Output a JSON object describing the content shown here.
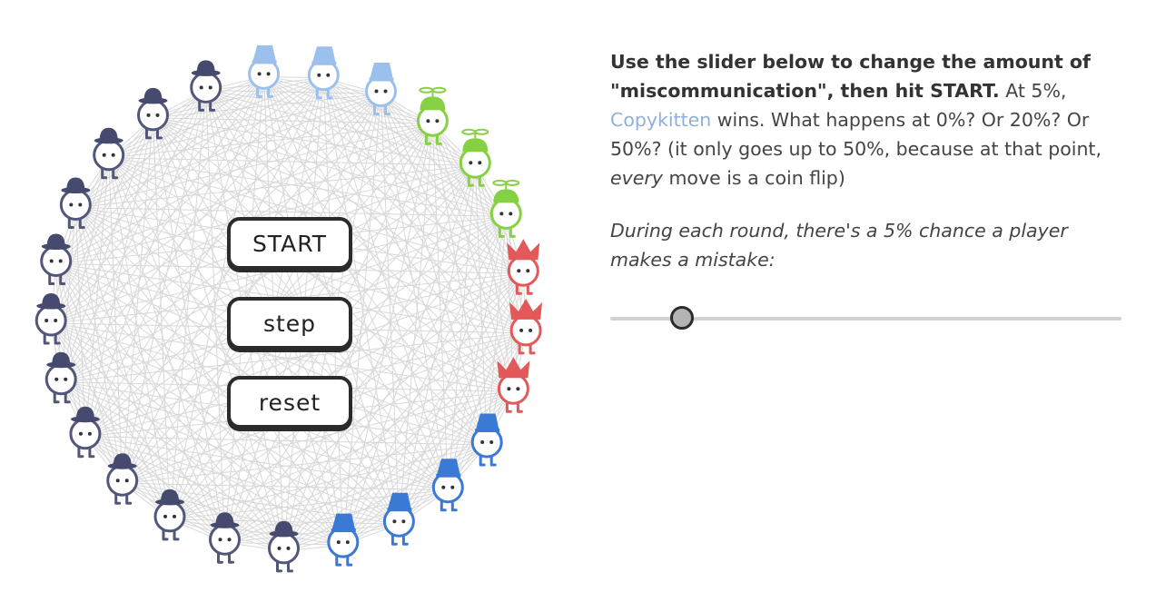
{
  "buttons": {
    "start": "START",
    "step": "step",
    "reset": "reset"
  },
  "words": {
    "bold_intro": "Use the slider below to change the amount of \"miscommunication\", then hit START.",
    "at_pre": " At 5%, ",
    "copykitten": "Copykitten",
    "at_post": " wins. What happens at 0%? Or 20%? Or 50%? (it only goes up to 50%, because at that point, ",
    "every": "every",
    "tail": " move is a coin flip)",
    "label": "During each round, there's a 5% chance a player makes a mistake:"
  },
  "slider": {
    "value_percent": 5,
    "min_percent": 0,
    "max_percent": 50
  },
  "colors": {
    "copykitten_text": "#8fb0d8",
    "network_lines": "#d8d8d8",
    "bowler_hat": "#454a6e",
    "bowler_body": "#52577a",
    "copycat_hat": "#3a7ad4",
    "copykitten_hat": "#9cc0ee",
    "propeller_hat": "#86d043",
    "jester_hat": "#e35858"
  },
  "players": [
    {
      "hat": "copykitten",
      "icon": "bucket-hat-icon"
    },
    {
      "hat": "copykitten",
      "icon": "bucket-hat-icon"
    },
    {
      "hat": "copykitten",
      "icon": "bucket-hat-icon"
    },
    {
      "hat": "propeller",
      "icon": "propeller-cap-icon"
    },
    {
      "hat": "propeller",
      "icon": "propeller-cap-icon"
    },
    {
      "hat": "propeller",
      "icon": "propeller-cap-icon"
    },
    {
      "hat": "jester",
      "icon": "jester-hat-icon"
    },
    {
      "hat": "jester",
      "icon": "jester-hat-icon"
    },
    {
      "hat": "jester",
      "icon": "jester-hat-icon"
    },
    {
      "hat": "copycat",
      "icon": "bucket-hat-icon"
    },
    {
      "hat": "copycat",
      "icon": "bucket-hat-icon"
    },
    {
      "hat": "copycat",
      "icon": "bucket-hat-icon"
    },
    {
      "hat": "copycat",
      "icon": "bucket-hat-icon"
    },
    {
      "hat": "bowler",
      "icon": "bowler-hat-icon"
    },
    {
      "hat": "bowler",
      "icon": "bowler-hat-icon"
    },
    {
      "hat": "bowler",
      "icon": "bowler-hat-icon"
    },
    {
      "hat": "bowler",
      "icon": "bowler-hat-icon"
    },
    {
      "hat": "bowler",
      "icon": "bowler-hat-icon"
    },
    {
      "hat": "bowler",
      "icon": "bowler-hat-icon"
    },
    {
      "hat": "bowler",
      "icon": "bowler-hat-icon"
    },
    {
      "hat": "bowler",
      "icon": "bowler-hat-icon"
    },
    {
      "hat": "bowler",
      "icon": "bowler-hat-icon"
    },
    {
      "hat": "bowler",
      "icon": "bowler-hat-icon"
    },
    {
      "hat": "bowler",
      "icon": "bowler-hat-icon"
    },
    {
      "hat": "bowler",
      "icon": "bowler-hat-icon"
    }
  ]
}
